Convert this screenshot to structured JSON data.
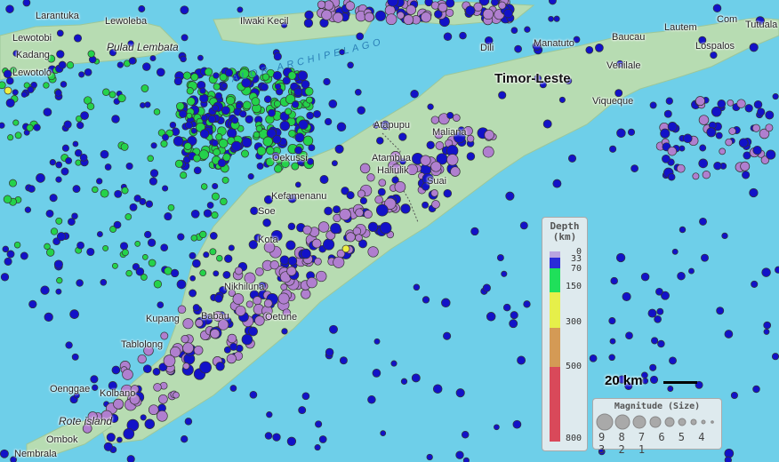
{
  "map": {
    "places": [
      {
        "name": "Larantuka",
        "id": "larantuka"
      },
      {
        "name": "Lewoleba",
        "id": "lewoleba"
      },
      {
        "name": "Lewotobi",
        "id": "lewotobi"
      },
      {
        "name": "Kadang",
        "id": "kadang"
      },
      {
        "name": "Lewotolo",
        "id": "lewotolo"
      },
      {
        "name": "Pulau Lembata",
        "id": "pulau-lembata"
      },
      {
        "name": "Ilwaki Kecil",
        "id": "ilwaki"
      },
      {
        "name": "Dili",
        "id": "dili"
      },
      {
        "name": "Manatuto",
        "id": "manatuto"
      },
      {
        "name": "Baucau",
        "id": "baucau"
      },
      {
        "name": "Lautem",
        "id": "lautem"
      },
      {
        "name": "Com",
        "id": "com"
      },
      {
        "name": "Tutuala",
        "id": "tutuala"
      },
      {
        "name": "Lospalos",
        "id": "lospalos"
      },
      {
        "name": "Venilale",
        "id": "venilale"
      },
      {
        "name": "Timor-Leste",
        "id": "timor-leste"
      },
      {
        "name": "Viqueque",
        "id": "viqueque"
      },
      {
        "name": "Atapupu",
        "id": "atapupu"
      },
      {
        "name": "Maliana",
        "id": "maliana"
      },
      {
        "name": "Atambua",
        "id": "atambua"
      },
      {
        "name": "Haliulik",
        "id": "haliulik"
      },
      {
        "name": "Suai",
        "id": "suai"
      },
      {
        "name": "Kefamenanu",
        "id": "kefamenanu"
      },
      {
        "name": "Oekussi",
        "id": "oekussi"
      },
      {
        "name": "Soe",
        "id": "soe"
      },
      {
        "name": "Kota",
        "id": "kota"
      },
      {
        "name": "Nikhiluna",
        "id": "nikhiluna"
      },
      {
        "name": "Babau",
        "id": "babau"
      },
      {
        "name": "Oetune",
        "id": "oetune"
      },
      {
        "name": "Kupang",
        "id": "kupang"
      },
      {
        "name": "Tablolong",
        "id": "tablolong"
      },
      {
        "name": "Oenggae",
        "id": "oenggae"
      },
      {
        "name": "Kolbano",
        "id": "kolbano"
      },
      {
        "name": "Rote island",
        "id": "rote-island"
      },
      {
        "name": "Ombok",
        "id": "ombok"
      },
      {
        "name": "Nembrala",
        "id": "nembrala"
      },
      {
        "name": "ALOR ARCHIPELAGO",
        "id": "alor-archipelago"
      }
    ],
    "scale_label": "20 km"
  },
  "legend": {
    "depth_title": "Depth\n(km)",
    "depth_ticks": [
      "0",
      "33",
      "70",
      "150",
      "300",
      "500",
      "800"
    ],
    "depth_colors": {
      "0-33": "#b9a4e0",
      "33-70": "#2a2ad8",
      "70-150": "#1fe05a",
      "150-300": "#e6ef4a",
      "300-500": "#d49a55",
      "500-800": "#d9495a"
    },
    "magnitude_title": "Magnitude (Size)",
    "magnitudes": "9 8 7 6 5 4 3 2 1"
  },
  "colors": {
    "sea": "#6ecfe9",
    "land": "#b5dbb0",
    "shallow": "#b07fcf",
    "intermediate": "#1212c8",
    "deep": "#24d24a",
    "very_deep": "#eeee40"
  }
}
